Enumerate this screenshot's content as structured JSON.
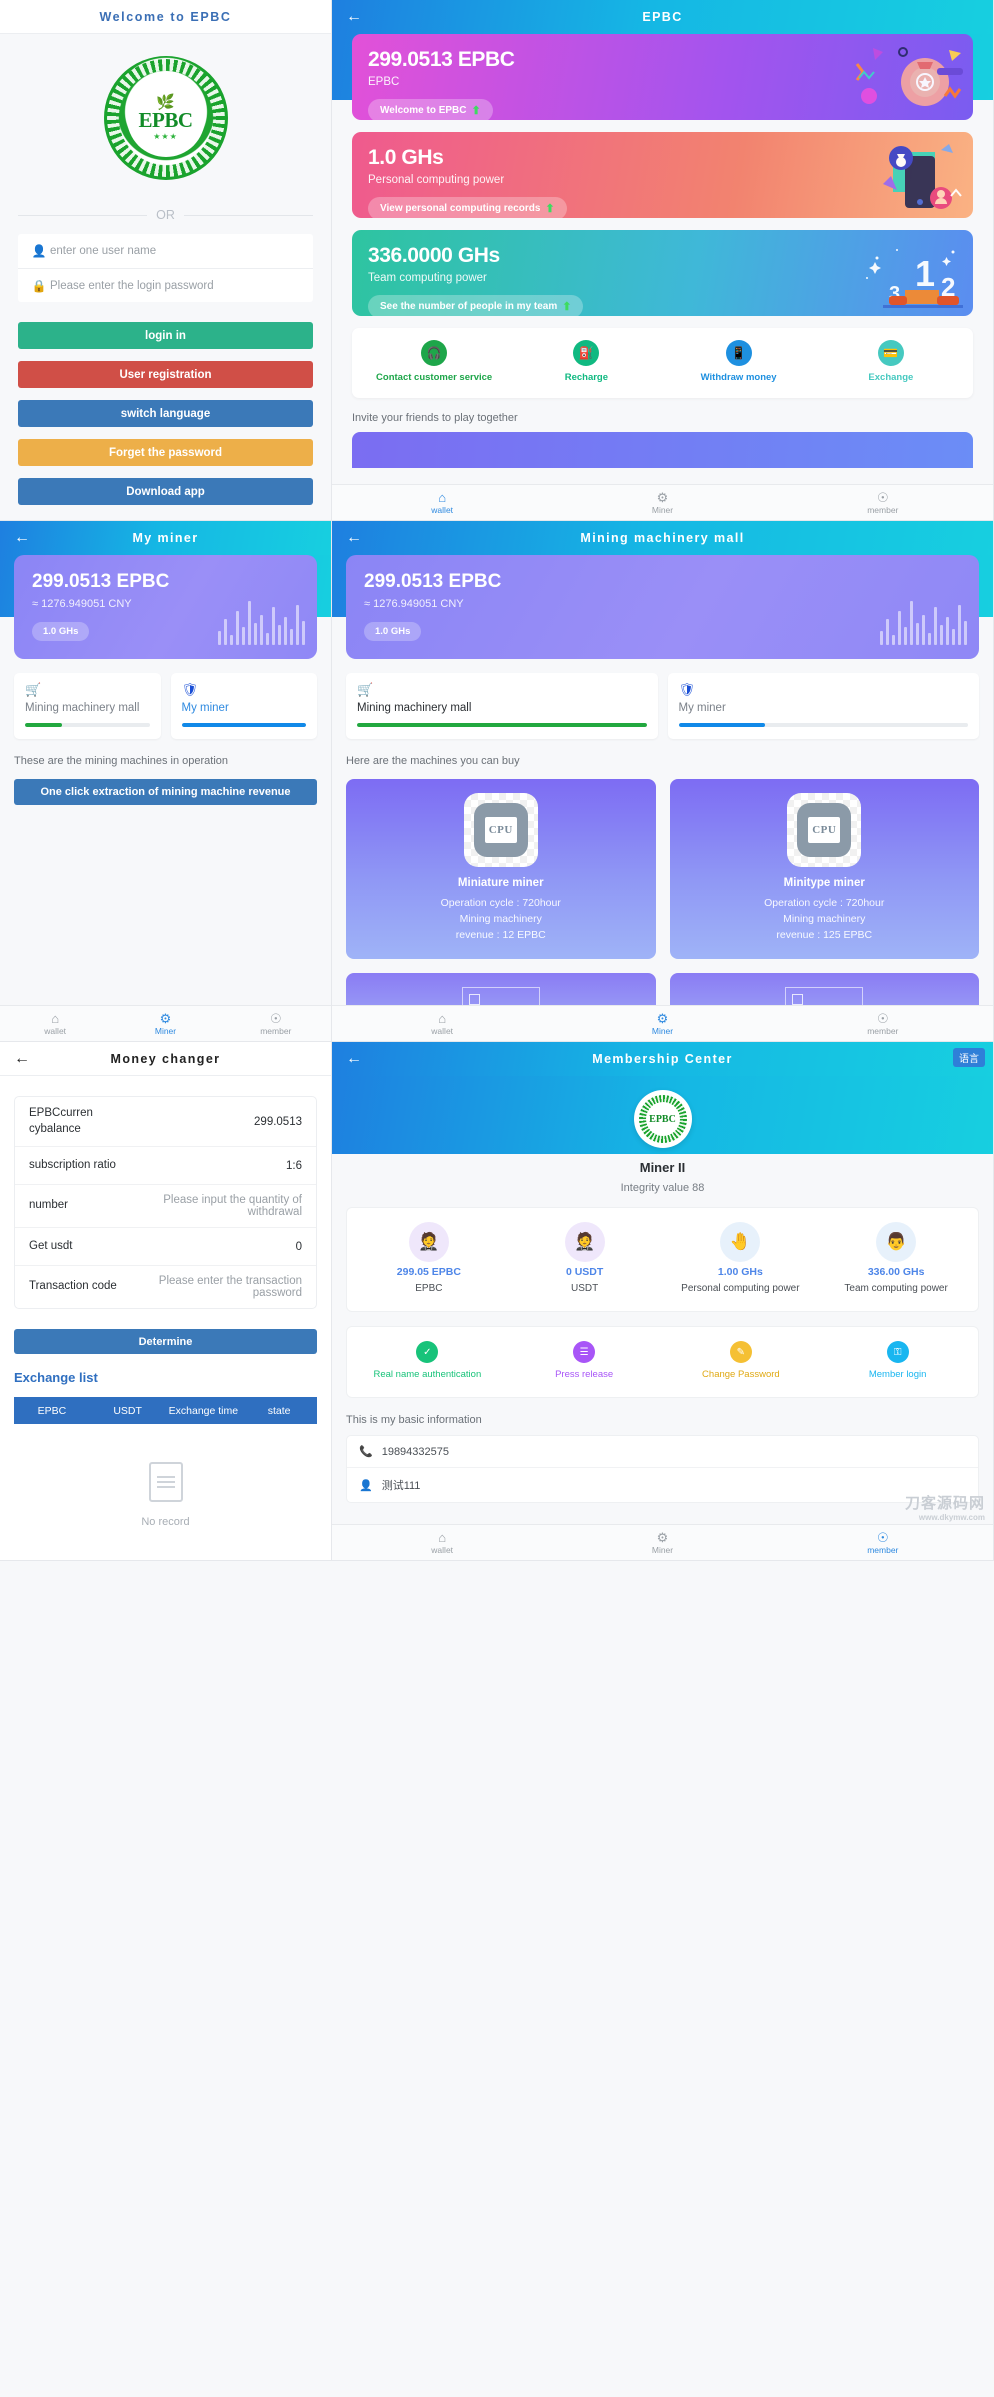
{
  "login": {
    "header_title": "Welcome to EPBC",
    "logo_text": "EPBC",
    "divider_label": "OR",
    "username_placeholder": "enter one user name",
    "password_placeholder": "Please enter the login password",
    "buttons": [
      {
        "label": "login in",
        "color": "#2cb28a"
      },
      {
        "label": "User registration",
        "color": "#d04f47"
      },
      {
        "label": "switch language",
        "color": "#3b79b8"
      },
      {
        "label": "Forget the password",
        "color": "#edaf49"
      },
      {
        "label": "Download app",
        "color": "#3b79b8"
      }
    ]
  },
  "wallet": {
    "header_title": "EPBC",
    "cards": [
      {
        "amount": "299.0513 EPBC",
        "sub": "EPBC",
        "pill": "Welcome to EPBC"
      },
      {
        "amount": "1.0 GHs",
        "sub": "Personal computing power",
        "pill": "View personal computing records"
      },
      {
        "amount": "336.0000 GHs",
        "sub": "Team computing power",
        "pill": "See the number of people in my team"
      }
    ],
    "actions": [
      {
        "label": "Contact customer service",
        "color": "#1ea64a",
        "icon": "headset-icon"
      },
      {
        "label": "Recharge",
        "color": "#10b981",
        "icon": "fuel-pump-icon"
      },
      {
        "label": "Withdraw money",
        "color": "#1e90e0",
        "icon": "phone-icon"
      },
      {
        "label": "Exchange",
        "color": "#46c9c0",
        "icon": "wallet-icon"
      }
    ],
    "invite_text": "Invite your friends to play together"
  },
  "tabbar": [
    {
      "label": "wallet",
      "icon": "home-icon",
      "active": true
    },
    {
      "label": "Miner",
      "icon": "coins-icon",
      "active": false
    },
    {
      "label": "member",
      "icon": "user-circle-icon",
      "active": false
    }
  ],
  "tabbar_miner": [
    {
      "label": "wallet",
      "icon": "home-icon",
      "active": false
    },
    {
      "label": "Miner",
      "icon": "coins-icon",
      "active": true
    },
    {
      "label": "member",
      "icon": "user-circle-icon",
      "active": false
    }
  ],
  "tabbar_member": [
    {
      "label": "wallet",
      "icon": "home-icon",
      "active": false
    },
    {
      "label": "Miner",
      "icon": "coins-icon",
      "active": false
    },
    {
      "label": "member",
      "icon": "user-circle-icon",
      "active": true
    }
  ],
  "miner": {
    "header_title": "My miner",
    "balance": "299.0513 EPBC",
    "cny": "≈ 1276.949051 CNY",
    "ghs": "1.0 GHs",
    "tabs": [
      {
        "label": "Mining machinery mall",
        "icon": "cart-icon",
        "progress": 30,
        "color": "#22a83f",
        "active": false
      },
      {
        "label": "My miner",
        "icon": "shield-icon",
        "progress": 100,
        "color": "#1189e8",
        "active": true
      }
    ],
    "hint": "These are the mining machines in operation",
    "extract_button": "One click extraction of mining machine revenue"
  },
  "mall": {
    "header_title": "Mining machinery mall",
    "balance": "299.0513 EPBC",
    "cny": "≈ 1276.949051 CNY",
    "ghs": "1.0 GHs",
    "tabs": [
      {
        "label": "Mining machinery mall",
        "icon": "cart-icon",
        "progress": 100,
        "color": "#22a83f",
        "active": true
      },
      {
        "label": "My miner",
        "icon": "shield-icon",
        "progress": 30,
        "color": "#1189e8",
        "active": false
      }
    ],
    "hint": "Here are the machines you can buy",
    "machines": [
      {
        "name": "Miniature miner",
        "chip": "CPU",
        "cycle": "Operation cycle : 720hour",
        "rev1": "Mining machinery",
        "rev2": "revenue : 12 EPBC"
      },
      {
        "name": "Minitype miner",
        "chip": "CPU",
        "cycle": "Operation cycle : 720hour",
        "rev1": "Mining machinery",
        "rev2": "revenue : 125 EPBC"
      }
    ]
  },
  "changer": {
    "header_title": "Money changer",
    "rows": [
      {
        "key": "EPBCcurren cybalance",
        "value": "299.0513",
        "placeholder": false
      },
      {
        "key": "subscription ratio",
        "value": "1:6",
        "placeholder": false
      },
      {
        "key": "number",
        "value": "Please input the quantity of withdrawal",
        "placeholder": true
      },
      {
        "key": "Get usdt",
        "value": "0",
        "placeholder": false
      },
      {
        "key": "Transaction code",
        "value": "Please enter the transaction password",
        "placeholder": true
      }
    ],
    "submit_label": "Determine",
    "list_title": "Exchange list",
    "columns": [
      "EPBC",
      "USDT",
      "Exchange time",
      "state"
    ],
    "empty_label": "No record"
  },
  "member": {
    "header_title": "Membership Center",
    "lang_button": "语言",
    "logo_text": "EPBC",
    "rank": "Miner II",
    "integrity": "Integrity value 88",
    "stats": [
      {
        "value": "299.05 EPBC",
        "caption": "EPBC",
        "icon": "coin-person-icon"
      },
      {
        "value": "0 USDT",
        "caption": "USDT",
        "icon": "coin-person-icon"
      },
      {
        "value": "1.00 GHs",
        "caption": "Personal computing power",
        "icon": "hand-phone-icon"
      },
      {
        "value": "336.00 GHs",
        "caption": "Team computing power",
        "icon": "team-person-icon"
      }
    ],
    "quick": [
      {
        "label": "Real name authentication",
        "color": "#18c37a",
        "text_color": "#18c37a",
        "icon": "shield-check-icon"
      },
      {
        "label": "Press release",
        "color": "#a855f7",
        "text_color": "#a855f7",
        "icon": "document-icon"
      },
      {
        "label": "Change Password",
        "color": "#f5c034",
        "text_color": "#e0a913",
        "icon": "pencil-icon"
      },
      {
        "label": "Member login",
        "color": "#19b6f0",
        "text_color": "#19b6f0",
        "icon": "key-icon"
      }
    ],
    "basic_title": "This is my basic information",
    "basic_rows": [
      {
        "icon": "phone-icon",
        "text": "19894332575"
      },
      {
        "icon": "user-icon",
        "text": "测试111"
      }
    ]
  },
  "watermark": {
    "main": "刀客源码网",
    "sub": "www.dkymw.com"
  }
}
